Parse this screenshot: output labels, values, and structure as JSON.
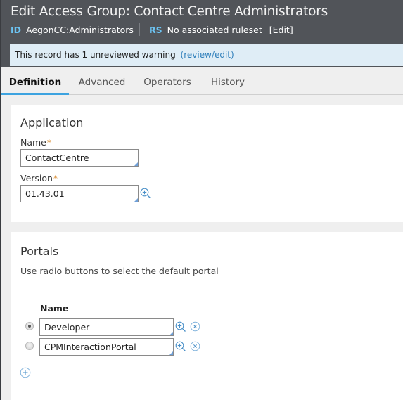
{
  "header": {
    "title": "Edit Access Group: Contact Centre Administrators",
    "id_tag": "ID",
    "id_value": "AegonCC:Administrators",
    "rs_tag": "RS",
    "rs_value": "No associated ruleset",
    "edit_label": "[Edit]"
  },
  "warning": {
    "text": "This record has  1 unreviewed warning ",
    "link": "(review/edit)"
  },
  "tabs": [
    {
      "label": "Definition",
      "active": true
    },
    {
      "label": "Advanced",
      "active": false
    },
    {
      "label": "Operators",
      "active": false
    },
    {
      "label": "History",
      "active": false
    }
  ],
  "application": {
    "heading": "Application",
    "name_label": "Name",
    "name_value": "ContactCentre",
    "version_label": "Version",
    "version_value": "01.43.01",
    "required_mark": "*"
  },
  "portals": {
    "heading": "Portals",
    "description": "Use radio buttons to select the default portal",
    "column_header": "Name",
    "rows": [
      {
        "name": "Developer",
        "default": true
      },
      {
        "name": "CPMInteractionPortal",
        "default": false
      }
    ]
  },
  "colors": {
    "header_bg": "#515459",
    "tag_blue": "#6cc3f2",
    "warning_bg": "#dfedf6",
    "link_blue": "#2f7fbb",
    "tab_accent": "#3da3e0",
    "required": "#d8892b",
    "icon_blue": "#4a90c8"
  }
}
